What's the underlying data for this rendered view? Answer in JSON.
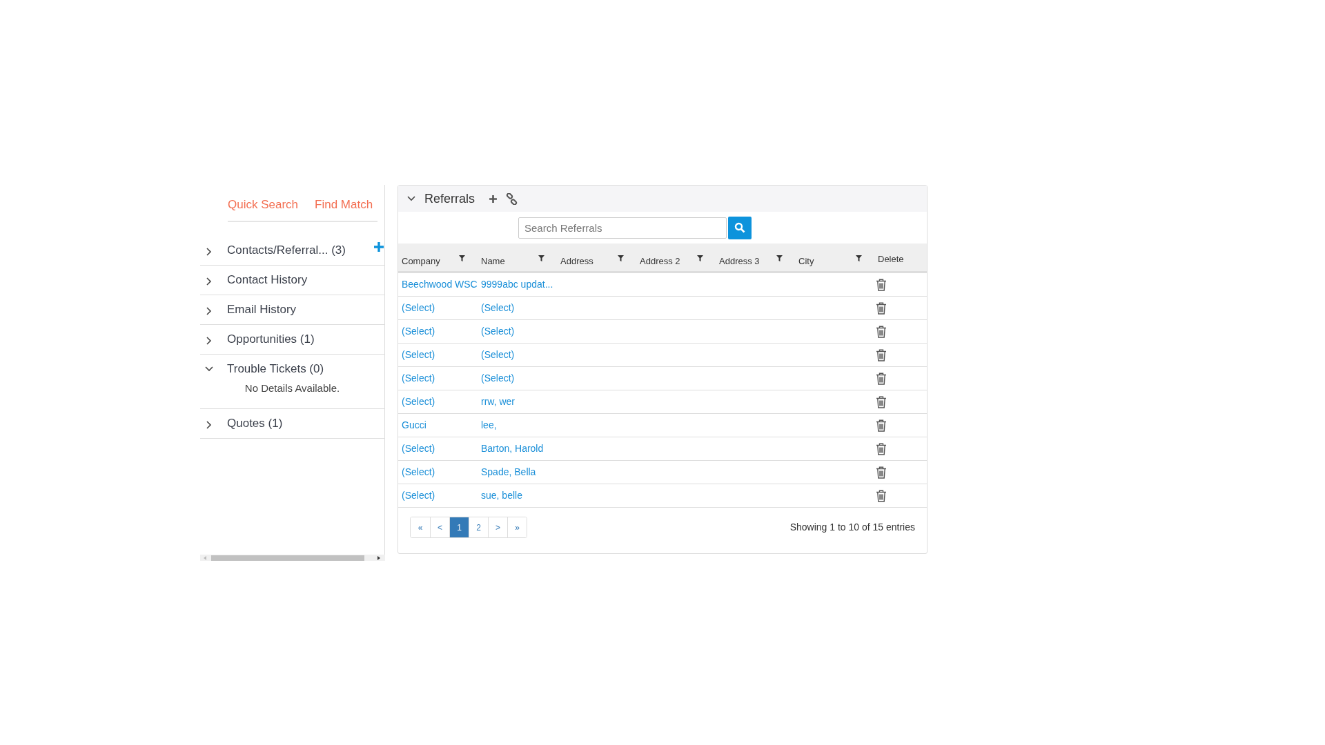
{
  "side_tabs": [
    {
      "label": "Quick Search"
    },
    {
      "label": "Find Match"
    }
  ],
  "sections": [
    {
      "label": "Contacts/Referral... (3)",
      "expanded": false,
      "add": true
    },
    {
      "label": "Contact History",
      "expanded": false,
      "add": false
    },
    {
      "label": "Email History",
      "expanded": false,
      "add": false
    },
    {
      "label": "Opportunities (1)",
      "expanded": false,
      "add": false
    },
    {
      "label": "Trouble Tickets (0)",
      "expanded": true,
      "add": false,
      "detail": "No Details Available."
    },
    {
      "label": "Quotes (1)",
      "expanded": false,
      "add": false
    }
  ],
  "panel": {
    "title": "Referrals",
    "expanded": true,
    "search_placeholder": "Search Referrals"
  },
  "table": {
    "columns": [
      {
        "label": "Company",
        "filter": true
      },
      {
        "label": "Name",
        "filter": true
      },
      {
        "label": "Address",
        "filter": true
      },
      {
        "label": "Address 2",
        "filter": true
      },
      {
        "label": "Address 3",
        "filter": true
      },
      {
        "label": "City",
        "filter": true
      },
      {
        "label": "Delete",
        "filter": false
      }
    ],
    "rows": [
      [
        "Beechwood WSC",
        "9999abc updat..."
      ],
      [
        "(Select)",
        "(Select)"
      ],
      [
        "(Select)",
        "(Select)"
      ],
      [
        "(Select)",
        "(Select)"
      ],
      [
        "(Select)",
        "(Select)"
      ],
      [
        "(Select)",
        "rrw, wer"
      ],
      [
        "Gucci",
        "lee,"
      ],
      [
        "(Select)",
        "Barton, Harold"
      ],
      [
        "(Select)",
        "Spade, Bella"
      ],
      [
        "(Select)",
        "sue, belle"
      ]
    ]
  },
  "pagination": {
    "pages": [
      {
        "label": "«",
        "selected": false
      },
      {
        "label": "<",
        "selected": false
      },
      {
        "label": "1",
        "selected": true
      },
      {
        "label": "2",
        "selected": false
      },
      {
        "label": ">",
        "selected": false
      },
      {
        "label": "»",
        "selected": false
      }
    ],
    "info": "Showing 1 to 10 of 15 entries"
  }
}
